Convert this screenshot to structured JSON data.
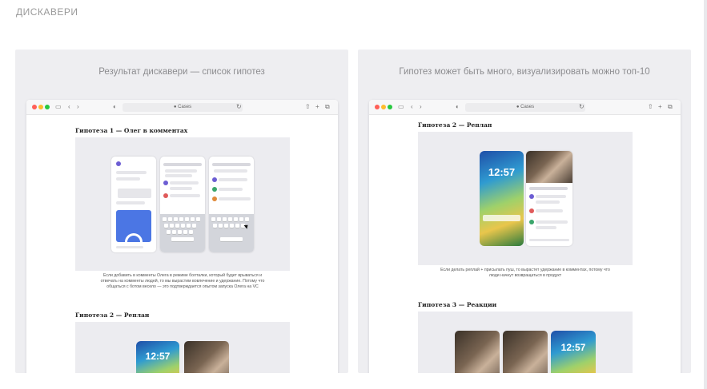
{
  "section": {
    "title": "ДИСКАВЕРИ"
  },
  "panels": [
    {
      "heading": "Результат дискавери — список гипотез",
      "browser": {
        "url": "Cases"
      },
      "hypotheses": [
        {
          "title": "Гипотеза 1 — Олег в комментах",
          "caption_lines": [
            "Если добавить в комменты Олега в режиме болталки, который будет врываться и",
            "отвечать на комменты людей, то мы вырастим вовлечение и удержание. Потому что",
            "общаться с ботом весело — это подтверждается опытом запуска Олега на VC"
          ]
        },
        {
          "title": "Гипотеза 2 — Реплан",
          "lock_time": "12:57"
        }
      ]
    },
    {
      "heading": "Гипотез может быть много, визуализировать можно топ-10",
      "browser": {
        "url": "Cases"
      },
      "hypotheses": [
        {
          "title": "Гипотеза 2 — Реплан",
          "lock_time": "12:57",
          "caption_lines": [
            "Если делать реплай + присылать пуш, то вырастет удержание в комментах, потому что",
            "люди начнут возвращаться в продукт"
          ]
        },
        {
          "title": "Гипотеза 3 — Реакции",
          "lock_time": "12:57"
        }
      ]
    }
  ],
  "colors": {
    "accent": "#4b76e4",
    "panel_bg": "#eeeef1",
    "muted_text": "#8c8c8f"
  },
  "icons": [
    "sidebar-icon",
    "back-icon",
    "forward-icon",
    "shield-icon",
    "lock-icon",
    "reload-icon",
    "share-icon",
    "plus-icon",
    "tabs-icon"
  ]
}
